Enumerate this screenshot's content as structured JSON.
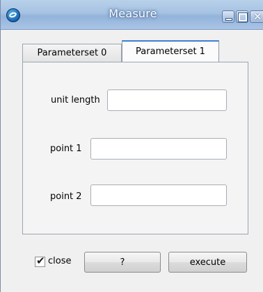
{
  "window": {
    "title": "Measure"
  },
  "titlebar_icons": {
    "app": "app-logo-icon",
    "minimize": "minimize-icon",
    "maximize": "maximize-icon",
    "close": "close-icon",
    "close_glyph": "✕"
  },
  "tabs": [
    {
      "label": "Parameterset 0",
      "selected": false
    },
    {
      "label": "Parameterset 1",
      "selected": true
    }
  ],
  "form": {
    "unit_length": {
      "label": "unit length",
      "value": ""
    },
    "point1": {
      "label": "point 1",
      "value": ""
    },
    "point2": {
      "label": "point 2",
      "value": ""
    }
  },
  "footer": {
    "close_checkbox": {
      "label": "close",
      "checked": true,
      "mark": "✔"
    },
    "help_button": "?",
    "execute_button": "execute"
  },
  "colors": {
    "titlebar": "#a6c2e2",
    "tab_accent": "#3c7fd1",
    "window_bg": "#f0f0f0"
  }
}
